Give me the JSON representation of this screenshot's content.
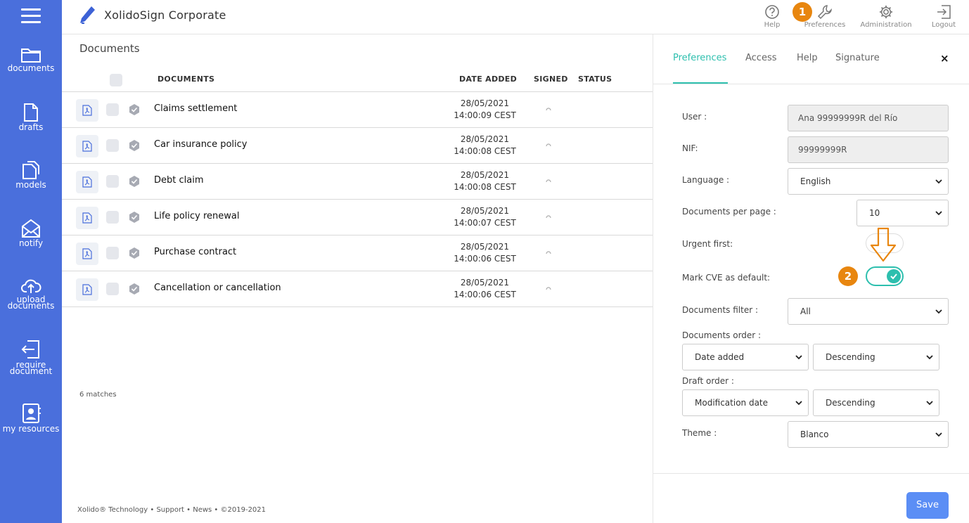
{
  "sidebar": {
    "items": [
      {
        "label": "documents",
        "icon": "folder-icon"
      },
      {
        "label": "drafts",
        "icon": "document-icon"
      },
      {
        "label": "models",
        "icon": "copy-icon"
      },
      {
        "label": "notify",
        "icon": "envelope-icon"
      },
      {
        "label": "upload documents",
        "label_line1": "upload",
        "label_line2": "documents",
        "icon": "cloud-upload-icon"
      },
      {
        "label": "require document",
        "label_line1": "require",
        "label_line2": "document",
        "icon": "sign-in-icon"
      },
      {
        "label": "my resources",
        "icon": "contact-book-icon"
      }
    ]
  },
  "header": {
    "title": "XolidoSign Corporate",
    "actions": [
      {
        "label": "Help",
        "icon": "question-circle-icon"
      },
      {
        "label": "Preferences",
        "icon": "wrench-icon"
      },
      {
        "label": "Administration",
        "icon": "gear-icon"
      },
      {
        "label": "Logout",
        "icon": "logout-icon"
      }
    ],
    "step1_badge": "1"
  },
  "main": {
    "page_title": "Documents",
    "columns": [
      "DOCUMENTS",
      "DATE ADDED",
      "SIGNED",
      "STATUS"
    ],
    "rows": [
      {
        "name": "Claims settlement",
        "date": "28/05/2021",
        "time": "14:00:09 CEST"
      },
      {
        "name": "Car insurance policy",
        "date": "28/05/2021",
        "time": "14:00:08 CEST"
      },
      {
        "name": "Debt claim",
        "date": "28/05/2021",
        "time": "14:00:08 CEST"
      },
      {
        "name": "Life policy renewal",
        "date": "28/05/2021",
        "time": "14:00:07 CEST"
      },
      {
        "name": "Purchase contract",
        "date": "28/05/2021",
        "time": "14:00:06 CEST"
      },
      {
        "name": "Cancellation or cancellation",
        "date": "28/05/2021",
        "time": "14:00:06 CEST"
      }
    ],
    "matches": "6 matches",
    "footer": "Xolido® Technology  •  Support  •  News  •  ©2019-2021"
  },
  "panel": {
    "tabs": [
      "Preferences",
      "Access",
      "Help",
      "Signature"
    ],
    "active_tab": "Preferences",
    "close": "×",
    "user_label": "User :",
    "user_value": "Ana 99999999R del Río",
    "nif_label": "NIF:",
    "nif_value": "99999999R",
    "language_label": "Language :",
    "language_value": "English",
    "docs_per_page_label": "Documents per page :",
    "docs_per_page_value": "10",
    "urgent_label": "Urgent first:",
    "urgent_on": false,
    "cve_label": "Mark CVE as default:",
    "cve_on": true,
    "step2_badge": "2",
    "filter_label": "Documents filter :",
    "filter_value": "All",
    "order_label": "Documents order :",
    "order_field": "Date added",
    "order_direction": "Descending",
    "draft_label": "Draft order :",
    "draft_field": "Modification date",
    "draft_direction": "Descending",
    "theme_label": "Theme :",
    "theme_value": "Blanco",
    "save": "Save"
  },
  "colors": {
    "sidebar": "#4a6fdc",
    "accent": "#2dbfae",
    "step_badge": "#e8860f",
    "save_button": "#5b8ef5"
  }
}
